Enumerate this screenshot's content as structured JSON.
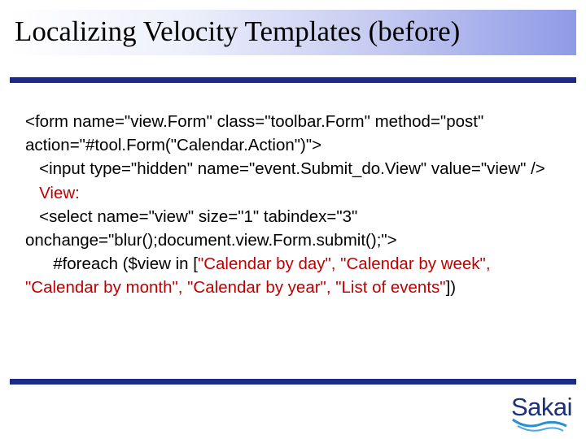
{
  "title": "Localizing Velocity Templates (before)",
  "code": {
    "line1": "<form name=\"view.Form\" class=\"toolbar.Form\" method=\"post\" action=\"#tool.Form(\"Calendar.Action\")\">",
    "line2": "   <input type=\"hidden\" name=\"event.Submit_do.View\" value=\"view\" />",
    "line3": "   View:",
    "line4": "   <select name=\"view\" size=\"1\" tabindex=\"3\" onchange=\"blur();document.view.Form.submit();\">",
    "line5_prefix": "      #foreach ($view in [",
    "line5_list": "\"Calendar by day\", \"Calendar by week\", \"Calendar by month\", \"Calendar by year\", \"List of events\"",
    "line5_suffix": "])"
  },
  "logo": {
    "text": "Sakai"
  },
  "colors": {
    "accent": "#1c2a8c",
    "highlight": "#c00000",
    "logo": "#1d2f7a"
  }
}
